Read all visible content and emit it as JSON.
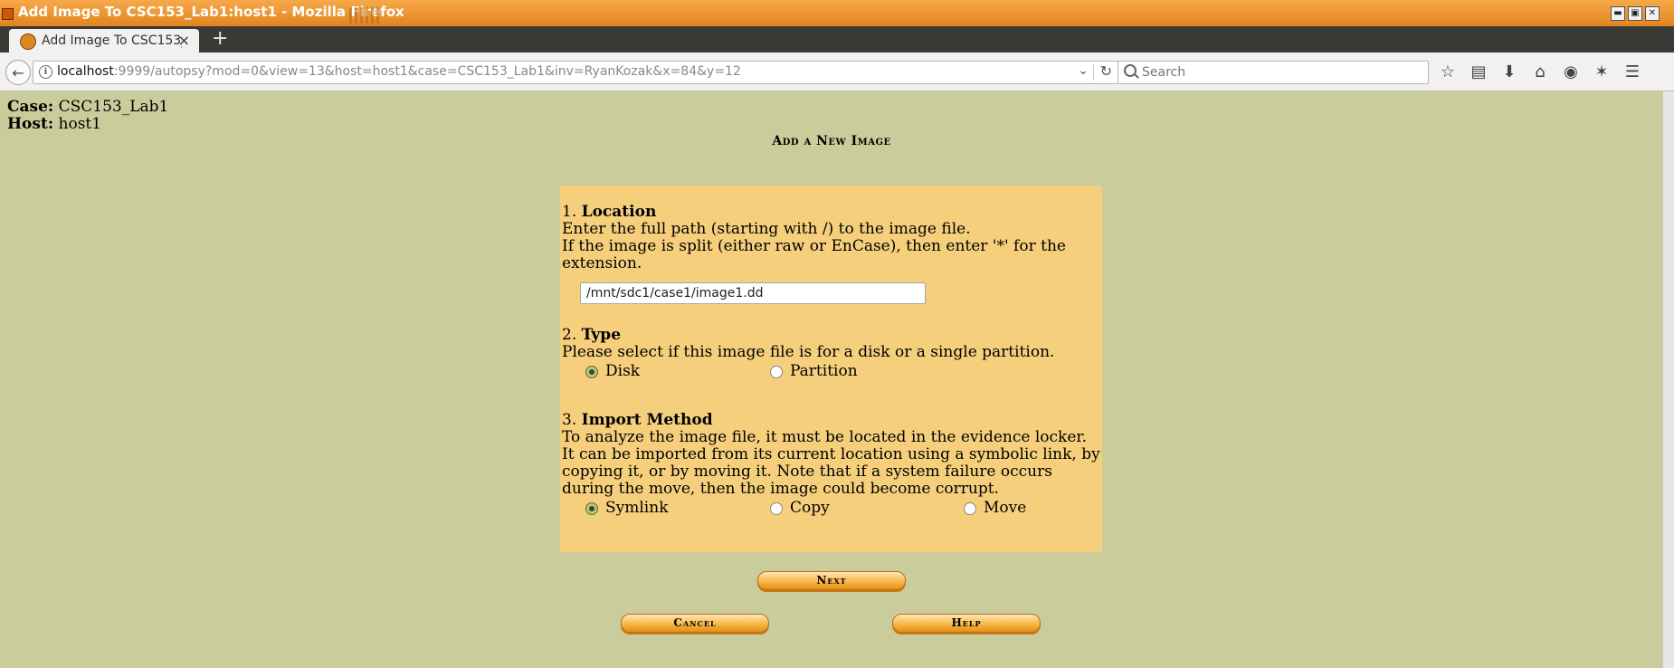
{
  "window": {
    "title": "Add Image To CSC153_Lab1:host1 - Mozilla Firefox",
    "buttons": {
      "minimize": "▬",
      "maximize": "▣",
      "close": "✕"
    }
  },
  "tab": {
    "title": "Add Image To CSC153_",
    "close": "×",
    "new_tab": "+"
  },
  "nav": {
    "url_host": "localhost",
    "url_rest": ":9999/autopsy?mod=0&view=13&host=host1&case=CSC153_Lab1&inv=RyanKozak&x=84&y=12",
    "search_placeholder": "Search",
    "icons": [
      "star-icon",
      "reading-list-icon",
      "download-icon",
      "home-icon",
      "pocket-icon",
      "extension-icon",
      "menu-icon"
    ]
  },
  "page": {
    "case_label": "Case:",
    "case_value": "CSC153_Lab1",
    "host_label": "Host:",
    "host_value": "host1",
    "heading": "Add a New Image"
  },
  "form": {
    "location": {
      "number": "1.",
      "title": "Location",
      "line1": "Enter the full path (starting with /) to the image file.",
      "line2": "If the image is split (either raw or EnCase), then enter '*' for the extension.",
      "path_value": "/mnt/sdc1/case1/image1.dd"
    },
    "type": {
      "number": "2.",
      "title": "Type",
      "desc": "Please select if this image file is for a disk or a single partition.",
      "options": [
        "Disk",
        "Partition"
      ],
      "selected": "Disk"
    },
    "import": {
      "number": "3.",
      "title": "Import Method",
      "desc": "To analyze the image file, it must be located in the evidence locker. It can be imported from its current location using a symbolic link, by copying it, or by moving it. Note that if a system failure occurs during the move, then the image could become corrupt.",
      "options": [
        "Symlink",
        "Copy",
        "Move"
      ],
      "selected": "Symlink"
    }
  },
  "buttons": {
    "next": "Next",
    "cancel": "Cancel",
    "help": "Help"
  },
  "colors": {
    "page_bg": "#cbcc9b",
    "panel_bg": "#f5cf7c",
    "title_bar": "#e98f24",
    "button": "#f7b748"
  }
}
